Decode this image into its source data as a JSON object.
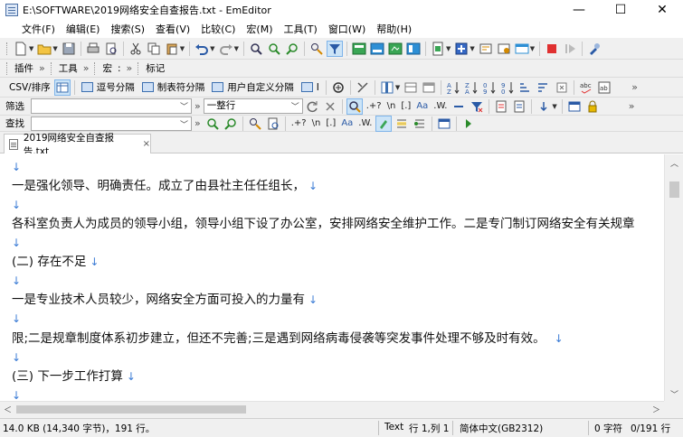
{
  "window": {
    "title": "E:\\SOFTWARE\\2019网络安全自查报告.txt - EmEditor",
    "minimize": "—",
    "maximize": "☐",
    "close": "✕"
  },
  "menu": [
    "文件(F)",
    "编辑(E)",
    "搜索(S)",
    "查看(V)",
    "比较(C)",
    "宏(M)",
    "工具(T)",
    "窗口(W)",
    "帮助(H)"
  ],
  "toolbar2": {
    "plugins": "插件",
    "tools": "工具",
    "macros": "宏",
    "macro_hint": ":",
    "bookmarks": "标记",
    "chev": "»"
  },
  "csvbar": {
    "label": "CSV/排序",
    "comma": "逗号分隔",
    "tab": "制表符分隔",
    "user": "用户自定义分隔",
    "pipe": "I"
  },
  "filter": {
    "label": "筛选",
    "value": "",
    "mode": "一整行",
    "regex": ".+?",
    "newline": "\\n",
    "bracket": "[.]",
    "case": "Aa",
    "word": ".W."
  },
  "find": {
    "label": "查找",
    "value": "",
    "regex": ".+?",
    "newline": "\\n",
    "bracket": "[.]",
    "case": "Aa",
    "word": ".W."
  },
  "tab": {
    "name": "2019网络安全自查报告.txt",
    "close": "×"
  },
  "lines": [
    "",
    "一是强化领导、明确责任。成立了由县社主任任组长，",
    "",
    "各科室负责人为成员的领导小组，领导小组下设了办公室，安排网络安全维护工作。二是专门制订网络安全有关规章",
    "",
    "(二) 存在不足",
    "",
    "一是专业技术人员较少，网络安全方面可投入的力量有",
    "",
    "限;二是规章制度体系初步建立，但还不完善;三是遇到网络病毒侵袭等突发事件处理不够及时有效。",
    "",
    "(三) 下一步工作打算",
    ""
  ],
  "newline_mark": "↓",
  "status": {
    "size": "14.0 KB (14,340 字节)，191 行。",
    "mode": "Text",
    "position": "行 1,列 1",
    "encoding": "简体中文(GB2312)",
    "selection": "0 字符",
    "lines": "0/191 行"
  }
}
